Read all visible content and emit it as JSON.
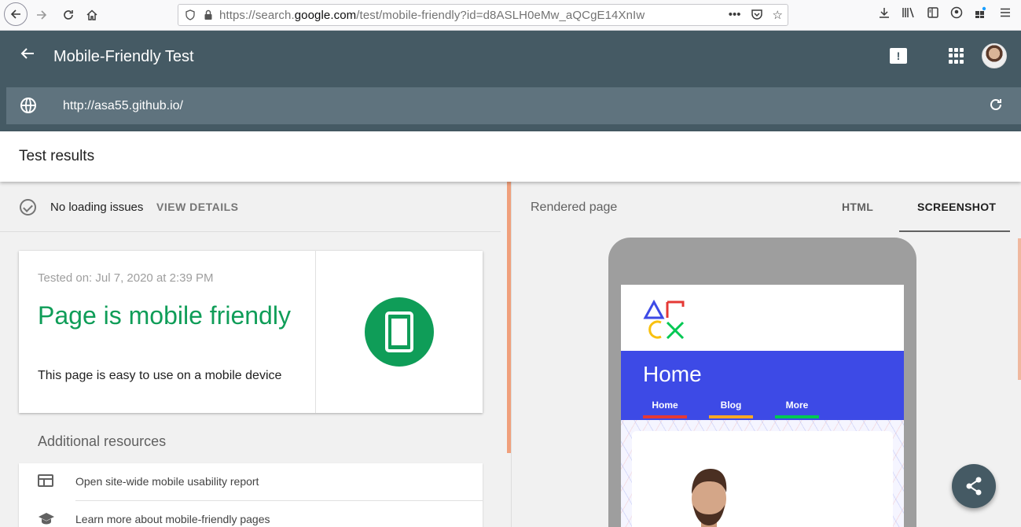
{
  "browser": {
    "url_prefix": "https://search.",
    "url_domain": "google.com",
    "url_suffix": "/test/mobile-friendly?id=d8ASLH0eMw_aQCgE14XnIw",
    "url_actions": [
      "more-icon",
      "pocket-icon",
      "bookmark-star-icon"
    ],
    "toolbar_icons": [
      "download-icon",
      "library-icon",
      "sidebar-icon",
      "account-icon",
      "extensions-icon",
      "menu-icon"
    ]
  },
  "app": {
    "title": "Mobile-Friendly Test",
    "tested_url": "http://asa55.github.io/",
    "header_color": "#455a64"
  },
  "results": {
    "title": "Test results",
    "status_text": "No loading issues",
    "view_details": "VIEW DETAILS",
    "tested_on": "Tested on: Jul 7, 2020 at 2:39 PM",
    "verdict": "Page is mobile friendly",
    "verdict_sub": "This page is easy to use on a mobile device",
    "verdict_color": "#0f9d58"
  },
  "resources": {
    "heading": "Additional resources",
    "items": [
      {
        "label": "Open site-wide mobile usability report",
        "icon": "report-icon"
      },
      {
        "label": "Learn more about mobile-friendly pages",
        "icon": "school-icon"
      }
    ]
  },
  "rendered": {
    "label": "Rendered page",
    "tabs": [
      "HTML",
      "SCREENSHOT"
    ],
    "active_tab": "SCREENSHOT"
  },
  "site_preview": {
    "hero_title": "Home",
    "nav": [
      {
        "label": "Home",
        "color": "#e53935"
      },
      {
        "label": "Blog",
        "color": "#f9a825"
      },
      {
        "label": "More",
        "color": "#00c853"
      }
    ],
    "hero_color": "#3d4ae6"
  }
}
